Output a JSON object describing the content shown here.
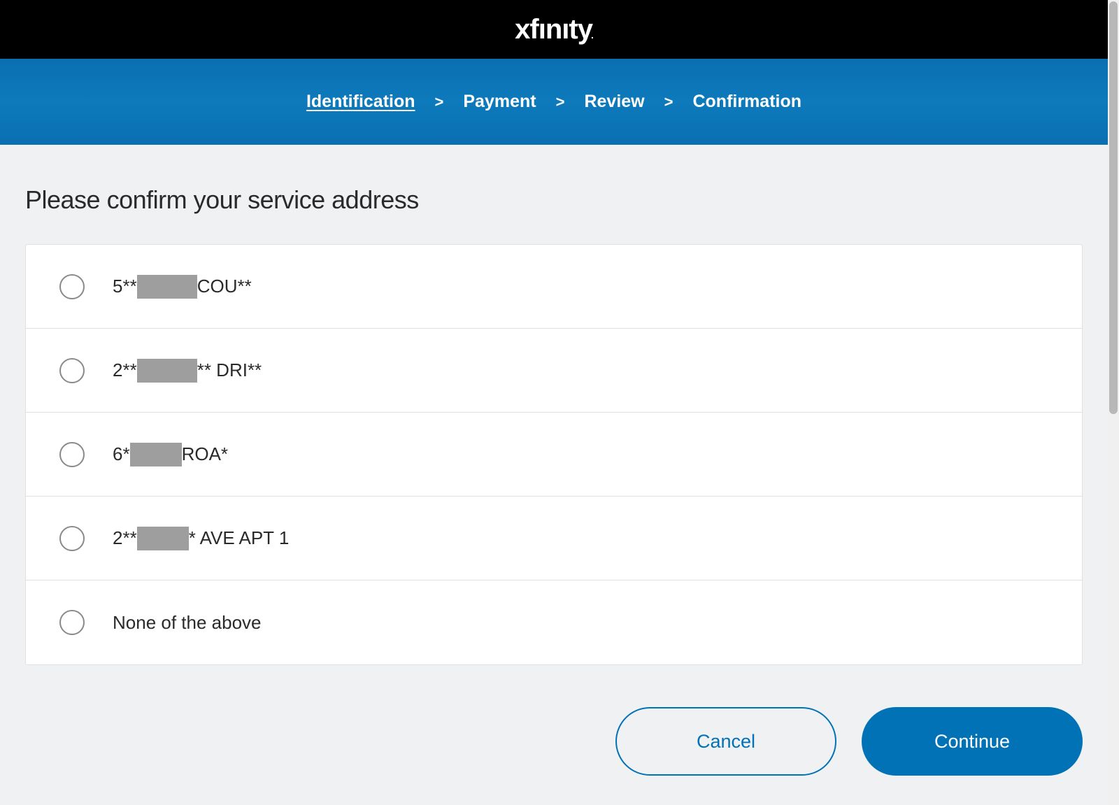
{
  "header": {
    "logo_text": "xfinity"
  },
  "progress": {
    "steps": [
      {
        "label": "Identification",
        "active": true
      },
      {
        "label": "Payment",
        "active": false
      },
      {
        "label": "Review",
        "active": false
      },
      {
        "label": "Confirmation",
        "active": false
      }
    ],
    "separator": ">"
  },
  "main": {
    "heading": "Please confirm your service address",
    "options": [
      {
        "prefix": "5**",
        "redact_width": 86,
        "suffix": " COU**"
      },
      {
        "prefix": "2**",
        "redact_width": 86,
        "suffix": "** DRI**"
      },
      {
        "prefix": "6* ",
        "redact_width": 74,
        "suffix": " ROA*"
      },
      {
        "prefix": "2**",
        "redact_width": 74,
        "suffix": "* AVE APT 1"
      },
      {
        "prefix": "None of the above",
        "redact_width": 0,
        "suffix": ""
      }
    ]
  },
  "actions": {
    "cancel_label": "Cancel",
    "continue_label": "Continue"
  }
}
